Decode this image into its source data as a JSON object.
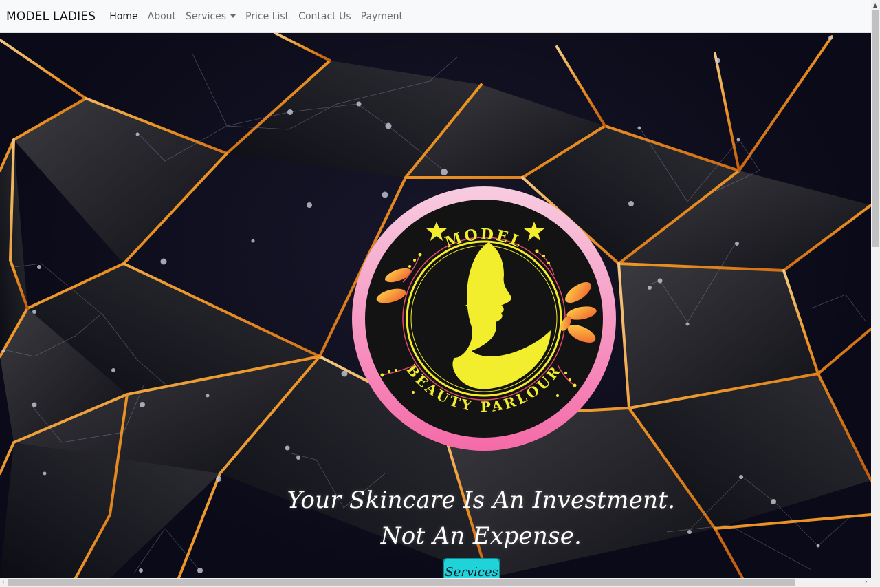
{
  "navbar": {
    "brand": "MODEL LADIES",
    "links": [
      {
        "label": "Home",
        "active": true
      },
      {
        "label": "About",
        "active": false
      },
      {
        "label": "Services",
        "active": false,
        "dropdown": true
      },
      {
        "label": "Price List",
        "active": false
      },
      {
        "label": "Contact Us",
        "active": false
      },
      {
        "label": "Payment",
        "active": false
      }
    ]
  },
  "hero": {
    "logo": {
      "top_text": "MODEL",
      "bottom_text": "BEAUTY PARLOUR",
      "colors": {
        "ring_top": "#f7c6dc",
        "ring_bottom": "#f56aa8",
        "face": "#f3f032",
        "leaf": "#f58a3c"
      }
    },
    "tagline_line1": "Your Skincare Is An Investment.",
    "tagline_line2": "Not An Expense.",
    "cta_label": "Services",
    "cta_color": "#1fd3d8"
  }
}
